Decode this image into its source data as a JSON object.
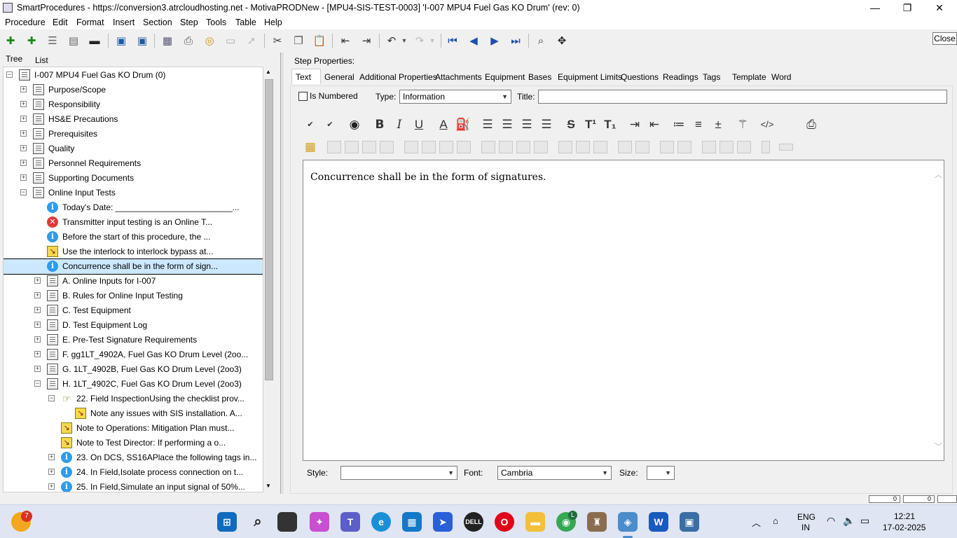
{
  "window": {
    "title": "SmartProcedures - https://conversion3.atrcloudhosting.net - MotivaPRODNew - [MPU4-SIS-TEST-0003] 'I-007 MPU4 Fuel Gas KO Drum' (rev: 0)",
    "minimize": "—",
    "maximize": "❐",
    "close": "✕"
  },
  "menu": [
    "Procedure",
    "Edit",
    "Format",
    "Insert",
    "Section",
    "Step",
    "Tools",
    "Table",
    "Help"
  ],
  "toolbar": {
    "close_label": "Close"
  },
  "left_tabs": {
    "tree": "Tree",
    "list": "List"
  },
  "tree": [
    {
      "label": "I-007 MPU4 Fuel Gas KO Drum (0)",
      "icon": "procedure-icon",
      "exp": "−",
      "level": 0
    },
    {
      "label": "Purpose/Scope",
      "icon": "procedure-icon",
      "exp": "+",
      "level": 1
    },
    {
      "label": "Responsibility",
      "icon": "procedure-icon",
      "exp": "+",
      "level": 1
    },
    {
      "label": "HS&E Precautions",
      "icon": "procedure-icon",
      "exp": "+",
      "level": 1
    },
    {
      "label": "Prerequisites",
      "icon": "procedure-icon",
      "exp": "+",
      "level": 1
    },
    {
      "label": "Quality",
      "icon": "procedure-icon",
      "exp": "+",
      "level": 1
    },
    {
      "label": "Personnel Requirements",
      "icon": "procedure-icon",
      "exp": "+",
      "level": 1
    },
    {
      "label": "Supporting Documents",
      "icon": "procedure-icon",
      "exp": "+",
      "level": 1
    },
    {
      "label": "Online Input Tests",
      "icon": "procedure-icon",
      "exp": "−",
      "level": 1
    },
    {
      "label": "Today's Date: _________________________...",
      "icon": "info-icon",
      "exp": "",
      "level": 2
    },
    {
      "label": "Transmitter input testing is an Online T...",
      "icon": "warning-icon",
      "exp": "",
      "level": 2
    },
    {
      "label": "Before the start of this procedure, the ...",
      "icon": "info-icon",
      "exp": "",
      "level": 2
    },
    {
      "label": "Use the interlock to interlock bypass at...",
      "icon": "note-icon",
      "exp": "",
      "level": 2
    },
    {
      "label": "Concurrence shall be in the form of sign...",
      "icon": "info-icon",
      "exp": "",
      "level": 2,
      "selected": true
    },
    {
      "label": "A. Online Inputs for I-007",
      "icon": "procedure-icon",
      "exp": "+",
      "level": 2
    },
    {
      "label": "B. Rules for Online Input Testing",
      "icon": "procedure-icon",
      "exp": "+",
      "level": 2
    },
    {
      "label": "C. Test Equipment",
      "icon": "procedure-icon",
      "exp": "+",
      "level": 2
    },
    {
      "label": "D. Test Equipment Log",
      "icon": "procedure-icon",
      "exp": "+",
      "level": 2
    },
    {
      "label": "E. Pre-Test Signature Requirements",
      "icon": "procedure-icon",
      "exp": "+",
      "level": 2
    },
    {
      "label": "F. gg1LT_4902A, Fuel Gas KO Drum Level (2oo...",
      "icon": "procedure-icon",
      "exp": "+",
      "level": 2
    },
    {
      "label": "G. 1LT_4902B, Fuel Gas KO Drum Level (2oo3)",
      "icon": "procedure-icon",
      "exp": "+",
      "level": 2
    },
    {
      "label": "H. 1LT_4902C, Fuel Gas KO Drum Level (2oo3)",
      "icon": "procedure-icon",
      "exp": "−",
      "level": 2
    },
    {
      "label": "22. Field InspectionUsing the checklist prov...",
      "icon": "hand-icon",
      "exp": "−",
      "level": 3
    },
    {
      "label": "Note any issues with SIS installation. A...",
      "icon": "note-icon",
      "exp": "",
      "level": 4
    },
    {
      "label": "Note to Operations: Mitigation Plan must...",
      "icon": "note-icon",
      "exp": "",
      "level": 3
    },
    {
      "label": "Note to Test Director: If performing a o...",
      "icon": "note-icon",
      "exp": "",
      "level": 3
    },
    {
      "label": "23. On DCS, SS16APlace the following tags in...",
      "icon": "info-icon",
      "exp": "+",
      "level": 3
    },
    {
      "label": "24. In Field,Isolate process connection on t...",
      "icon": "info-icon",
      "exp": "+",
      "level": 3
    },
    {
      "label": "25. In Field,Simulate an input signal of 50%...",
      "icon": "info-icon",
      "exp": "+",
      "level": 3
    }
  ],
  "step_properties": {
    "heading": "Step Properties:",
    "tabs": [
      "Text",
      "General",
      "Additional Properties",
      "Attachments",
      "Equipment",
      "Bases",
      "Equipment Limits",
      "Questions",
      "Readings",
      "Tags",
      "Template",
      "Word"
    ],
    "is_numbered_label": "Is Numbered",
    "type_label": "Type:",
    "type_value": "Information",
    "title_label": "Title:",
    "title_value": "",
    "editor_text": "Concurrence shall be in the form of signatures.",
    "style_label": "Style:",
    "style_value": "",
    "font_label": "Font:",
    "font_value": "Cambria",
    "size_label": "Size:",
    "size_value": ""
  },
  "status": {
    "left": "0",
    "right": "0"
  },
  "taskbar": {
    "notification_count": "7",
    "lang_line1": "ENG",
    "lang_line2": "IN",
    "time": "12:21",
    "date": "17-02-2025",
    "chrome_badge": "L"
  }
}
